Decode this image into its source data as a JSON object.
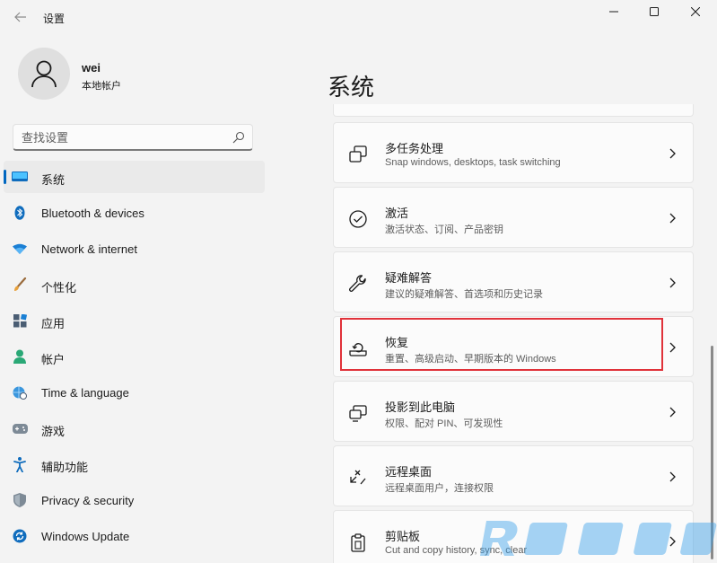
{
  "window": {
    "app_title": "设置",
    "controls": [
      "minimize",
      "maximize",
      "close"
    ]
  },
  "profile": {
    "name": "wei",
    "account_type": "本地帐户"
  },
  "search": {
    "placeholder": "查找设置"
  },
  "sidebar": {
    "items": [
      {
        "label": "系统",
        "icon": "system-icon",
        "selected": true
      },
      {
        "label": "Bluetooth & devices",
        "icon": "bluetooth-icon"
      },
      {
        "label": "Network & internet",
        "icon": "wifi-icon"
      },
      {
        "label": "个性化",
        "icon": "brush-icon"
      },
      {
        "label": "应用",
        "icon": "apps-icon"
      },
      {
        "label": "帐户",
        "icon": "person-icon"
      },
      {
        "label": "Time & language",
        "icon": "globe-clock-icon"
      },
      {
        "label": "游戏",
        "icon": "gamepad-icon"
      },
      {
        "label": "辅助功能",
        "icon": "accessibility-icon"
      },
      {
        "label": "Privacy & security",
        "icon": "shield-icon"
      },
      {
        "label": "Windows Update",
        "icon": "update-icon"
      }
    ]
  },
  "main": {
    "title": "系统",
    "cards": [
      {
        "title": "多任务处理",
        "desc": "Snap windows, desktops, task switching",
        "icon": "multitasking-icon"
      },
      {
        "title": "激活",
        "desc": "激活状态、订阅、产品密钥",
        "icon": "activation-icon"
      },
      {
        "title": "疑难解答",
        "desc": "建议的疑难解答、首选项和历史记录",
        "icon": "wrench-icon"
      },
      {
        "title": "恢复",
        "desc": "重置、高级启动、早期版本的 Windows",
        "icon": "recovery-icon",
        "highlighted": true
      },
      {
        "title": "投影到此电脑",
        "desc": "权限、配对 PIN、可发现性",
        "icon": "projection-icon"
      },
      {
        "title": "远程桌面",
        "desc": "远程桌面用户，连接权限",
        "icon": "remote-desktop-icon"
      },
      {
        "title": "剪贴板",
        "desc": "Cut and copy history, sync, clear",
        "icon": "clipboard-icon"
      }
    ]
  },
  "colors": {
    "accent": "#0067c0",
    "highlight_border": "#e0323a",
    "background": "#f3f3f3",
    "card": "#fbfbfb"
  }
}
